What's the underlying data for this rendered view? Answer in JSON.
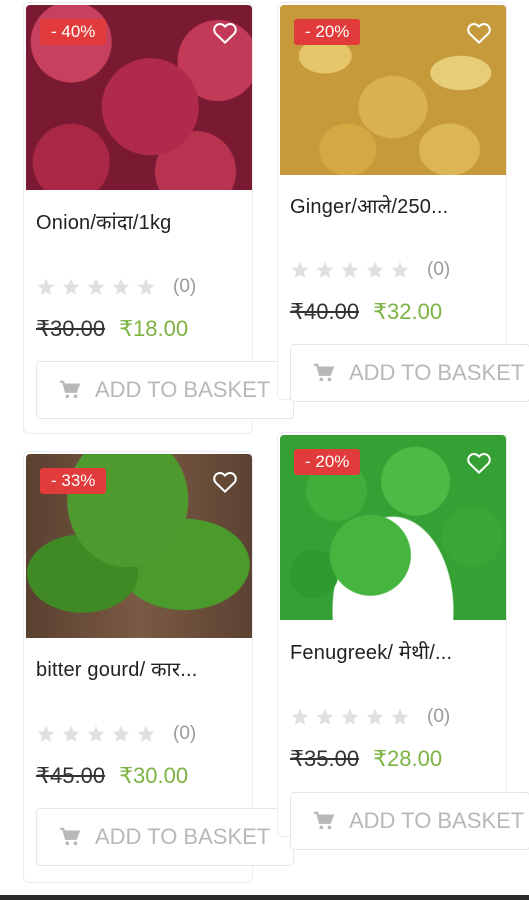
{
  "products": [
    {
      "discount": "- 40%",
      "title": "Onion/कांदा/1kg",
      "rating_count": "(0)",
      "old_price": "₹30.00",
      "new_price": "₹18.00",
      "basket_label": "ADD TO BASKET"
    },
    {
      "discount": "- 20%",
      "title": "Ginger/आले/250...",
      "rating_count": "(0)",
      "old_price": "₹40.00",
      "new_price": "₹32.00",
      "basket_label": "ADD TO BASKET"
    },
    {
      "discount": "- 33%",
      "title": "bitter gourd/ कार...",
      "rating_count": "(0)",
      "old_price": "₹45.00",
      "new_price": "₹30.00",
      "basket_label": "ADD TO BASKET"
    },
    {
      "discount": "- 20%",
      "title": "Fenugreek/ मेथी/...",
      "rating_count": "(0)",
      "old_price": "₹35.00",
      "new_price": "₹28.00",
      "basket_label": "ADD TO BASKET"
    }
  ],
  "colors": {
    "badge": "#e23b3b",
    "new_price": "#7cb342",
    "star": "#e0e0e0"
  },
  "icons": {
    "wishlist": "heart-icon",
    "basket": "cart-icon",
    "rating": "star-icon"
  }
}
